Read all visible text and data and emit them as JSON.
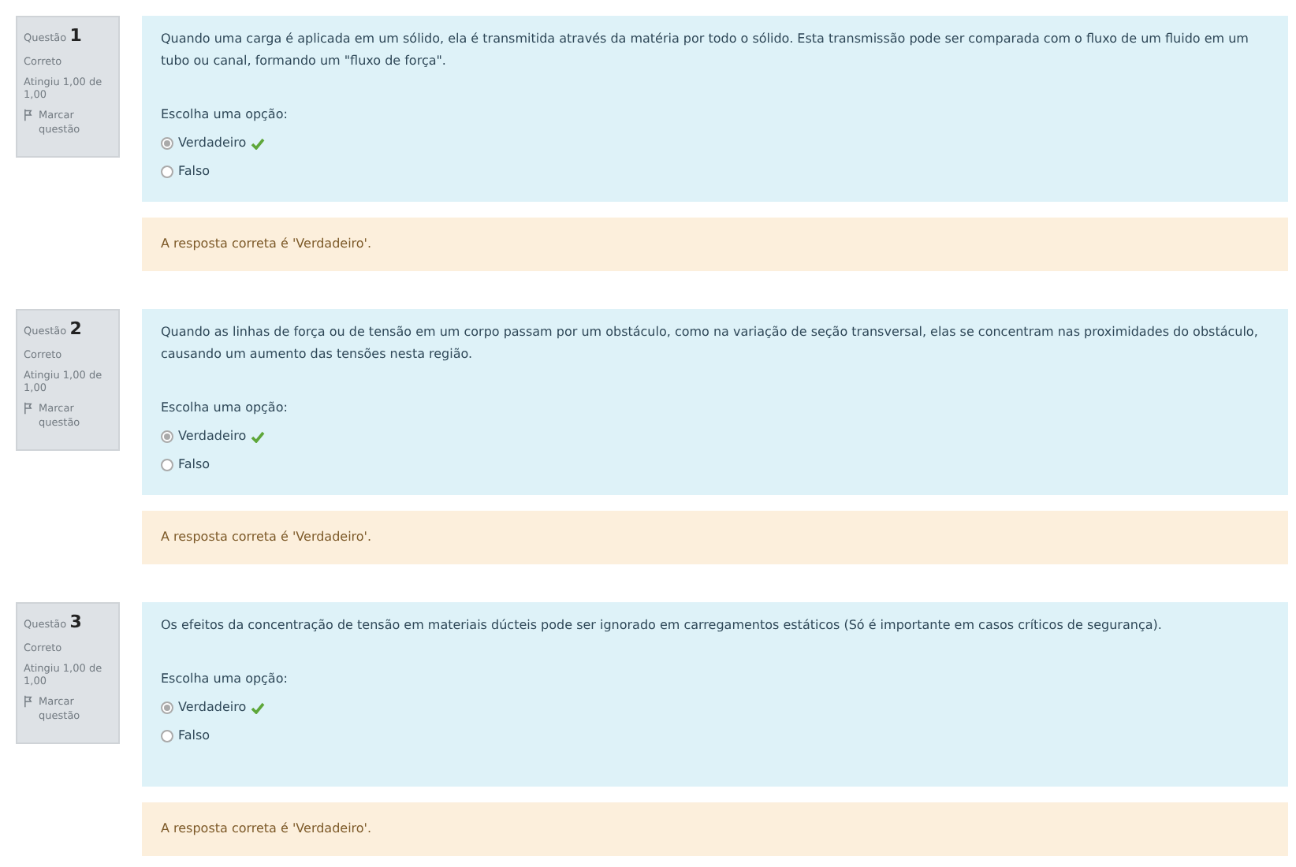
{
  "questions": [
    {
      "label": "Questão",
      "number": "1",
      "state": "Correto",
      "grade": "Atingiu 1,00 de 1,00",
      "flag": "Marcar questão",
      "text": "Quando uma carga é aplicada em um sólido, ela é transmitida através da matéria por todo o sólido. Esta transmissão  pode ser comparada com o fluxo de um fluido em um tubo ou canal, formando um \"fluxo de força\".",
      "prompt": "Escolha uma opção:",
      "options": [
        {
          "label": "Verdadeiro",
          "selected": true,
          "correct": true
        },
        {
          "label": "Falso",
          "selected": false,
          "correct": false
        }
      ],
      "feedback": "A resposta correta é 'Verdadeiro'."
    },
    {
      "label": "Questão",
      "number": "2",
      "state": "Correto",
      "grade": "Atingiu 1,00 de 1,00",
      "flag": "Marcar questão",
      "text": "Quando as linhas de força ou de tensão em um corpo passam por um obstáculo, como na variação de seção transversal, elas se concentram nas proximidades do obstáculo, causando um aumento das tensões nesta região.",
      "prompt": "Escolha uma opção:",
      "options": [
        {
          "label": "Verdadeiro",
          "selected": true,
          "correct": true
        },
        {
          "label": "Falso",
          "selected": false,
          "correct": false
        }
      ],
      "feedback": "A resposta correta é 'Verdadeiro'."
    },
    {
      "label": "Questão",
      "number": "3",
      "state": "Correto",
      "grade": "Atingiu 1,00 de 1,00",
      "flag": "Marcar questão",
      "text": "Os efeitos da concentração de tensão em materiais dúcteis pode ser ignorado em carregamentos estáticos (Só é importante em casos críticos de segurança).",
      "prompt": "Escolha uma opção:",
      "options": [
        {
          "label": "Verdadeiro",
          "selected": true,
          "correct": true
        },
        {
          "label": "Falso",
          "selected": false,
          "correct": false
        }
      ],
      "feedback": "A resposta correta é 'Verdadeiro'."
    }
  ]
}
